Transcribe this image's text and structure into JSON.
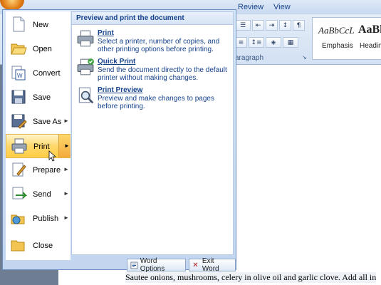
{
  "ribbon": {
    "tabs": [
      {
        "label": "Review"
      },
      {
        "label": "View"
      }
    ],
    "group_label": "aragraph",
    "styles": [
      {
        "preview": "AaBbCcL",
        "name": "Emphasis"
      },
      {
        "preview": "AaBl",
        "name": "Heading"
      }
    ]
  },
  "office_menu": {
    "commands": [
      {
        "label": "New",
        "icon": "new-document-icon",
        "arrow": false
      },
      {
        "label": "Open",
        "icon": "open-folder-icon",
        "arrow": false
      },
      {
        "label": "Convert",
        "icon": "convert-icon",
        "arrow": false
      },
      {
        "label": "Save",
        "icon": "save-icon",
        "arrow": false
      },
      {
        "label": "Save As",
        "icon": "save-as-icon",
        "arrow": true
      },
      {
        "label": "Print",
        "icon": "printer-icon",
        "arrow": true,
        "highlighted": true
      },
      {
        "label": "Prepare",
        "icon": "prepare-icon",
        "arrow": true
      },
      {
        "label": "Send",
        "icon": "send-icon",
        "arrow": true
      },
      {
        "label": "Publish",
        "icon": "publish-icon",
        "arrow": true
      },
      {
        "label": "Close",
        "icon": "close-folder-icon",
        "arrow": false
      }
    ],
    "submenu": {
      "title": "Preview and print the document",
      "items": [
        {
          "name": "Print",
          "desc": "Select a printer, number of copies, and other printing options before printing.",
          "icon": "printer-icon"
        },
        {
          "name": "Quick Print",
          "desc": "Send the document directly to the default printer without making changes.",
          "icon": "quick-print-icon"
        },
        {
          "name": "Print Preview",
          "desc": "Preview and make changes to pages before printing.",
          "icon": "print-preview-icon"
        }
      ]
    },
    "footer": {
      "options_label": "Word Options",
      "exit_label": "Exit Word"
    }
  },
  "document": {
    "text": "Sautee onions, mushrooms, celery in olive oil and garlic clove. Add all in"
  },
  "colors": {
    "highlight": "#ffd86b",
    "menu_border": "#6b8fc2",
    "text_blue": "#15428b"
  }
}
